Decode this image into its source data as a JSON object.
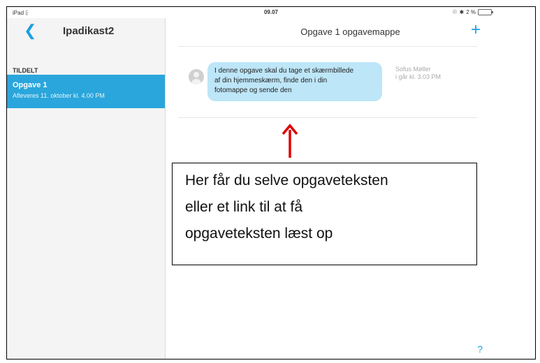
{
  "status_bar": {
    "device": "iPad",
    "time": "09.07",
    "battery": "2 %"
  },
  "sidebar": {
    "back_icon": "chevron-left-icon",
    "title": "Ipadikast2",
    "section_label": "TILDELT",
    "assignments": [
      {
        "title": "Opgave 1",
        "subtitle": "Afleveres 11. oktober kl. 4.00 PM"
      }
    ]
  },
  "main": {
    "title": "Opgave 1 opgavemappe",
    "add_icon": "plus-icon",
    "message": {
      "text_lines": [
        "I denne opgave skal du tage et skærmbillede",
        "af din hjemmeskærm, finde den i din",
        "fotomappe og sende den"
      ],
      "sender": "Sofus Møller",
      "timestamp": "i går kl. 3.03 PM"
    },
    "help_icon": "question-mark-icon"
  },
  "annotation": {
    "lines": [
      "Her får du selve opgaveteksten",
      "eller et link til at få",
      "opgaveteksten læst op"
    ],
    "arrow_color": "#e00000"
  },
  "colors": {
    "accent": "#1a9fe0",
    "selected_row": "#2aa6dc",
    "bubble": "#bde6f8"
  }
}
